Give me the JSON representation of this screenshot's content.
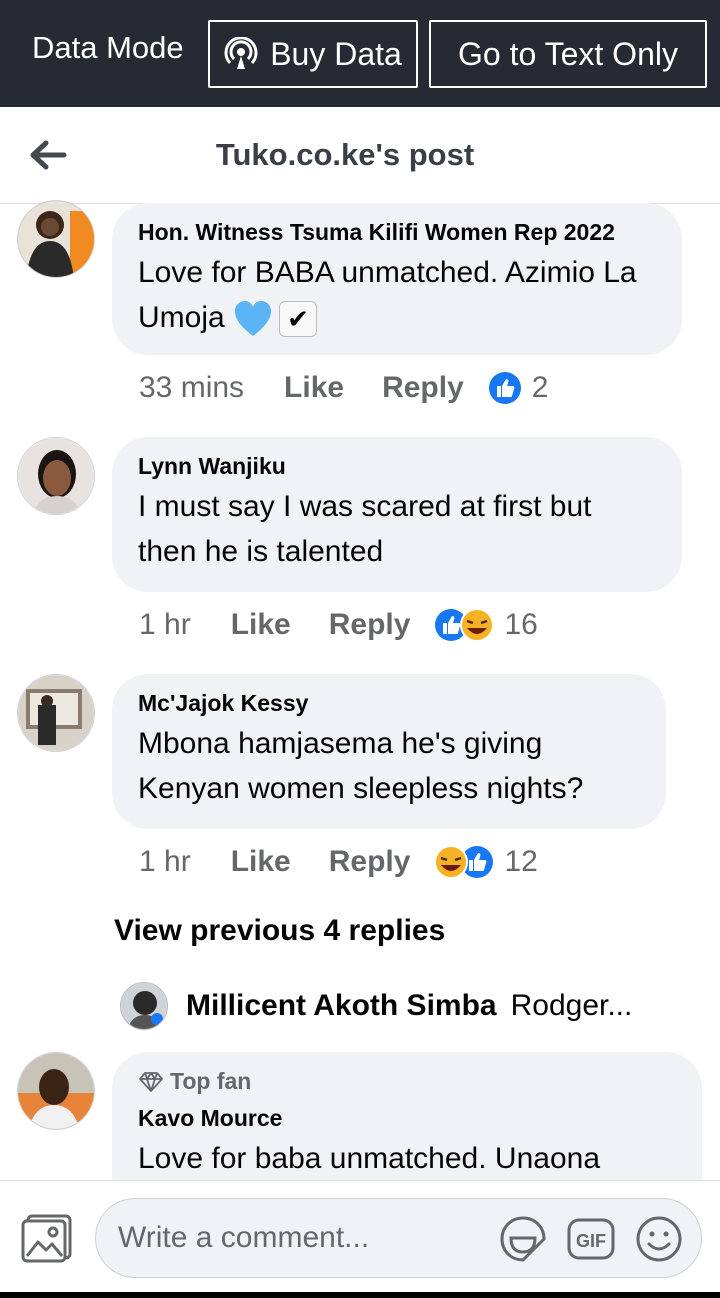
{
  "data_bar": {
    "label": "Data Mode",
    "buy_data": "Buy Data",
    "text_only": "Go to Text Only"
  },
  "header": {
    "title": "Tuko.co.ke's post"
  },
  "comments": [
    {
      "author": "Hon. Witness Tsuma Kilifi Women Rep 2022",
      "text": "Love for BABA unmatched. Azimio La Umoja",
      "time": "33 mins",
      "like": "Like",
      "reply": "Reply",
      "reaction_count": "2",
      "reactions": [
        "like-icon"
      ]
    },
    {
      "author": "Lynn Wanjiku",
      "text": "I must say I was scared at first but then he is talented",
      "time": "1 hr",
      "like": "Like",
      "reply": "Reply",
      "reaction_count": "16",
      "reactions": [
        "like-icon",
        "haha-icon"
      ]
    },
    {
      "author": "Mc'Jajok Kessy",
      "text": "Mbona hamjasema he's giving Kenyan women sleepless nights?",
      "time": "1 hr",
      "like": "Like",
      "reply": "Reply",
      "reaction_count": "12",
      "reactions": [
        "haha-icon",
        "like-icon"
      ]
    },
    {
      "badge": "Top fan",
      "author": "Kavo Mource",
      "text": "Love for baba unmatched. Unaona"
    }
  ],
  "view_previous": "View previous 4 replies",
  "reply_preview": {
    "name": "Millicent Akoth Simba",
    "snippet": "Rodger..."
  },
  "composer": {
    "placeholder": "Write a comment..."
  },
  "colors": {
    "data_bar_bg": "#262b33",
    "bubble_bg": "#f0f2f5",
    "like_blue": "#1877f2",
    "heart_blue": "#5ab4f5"
  }
}
